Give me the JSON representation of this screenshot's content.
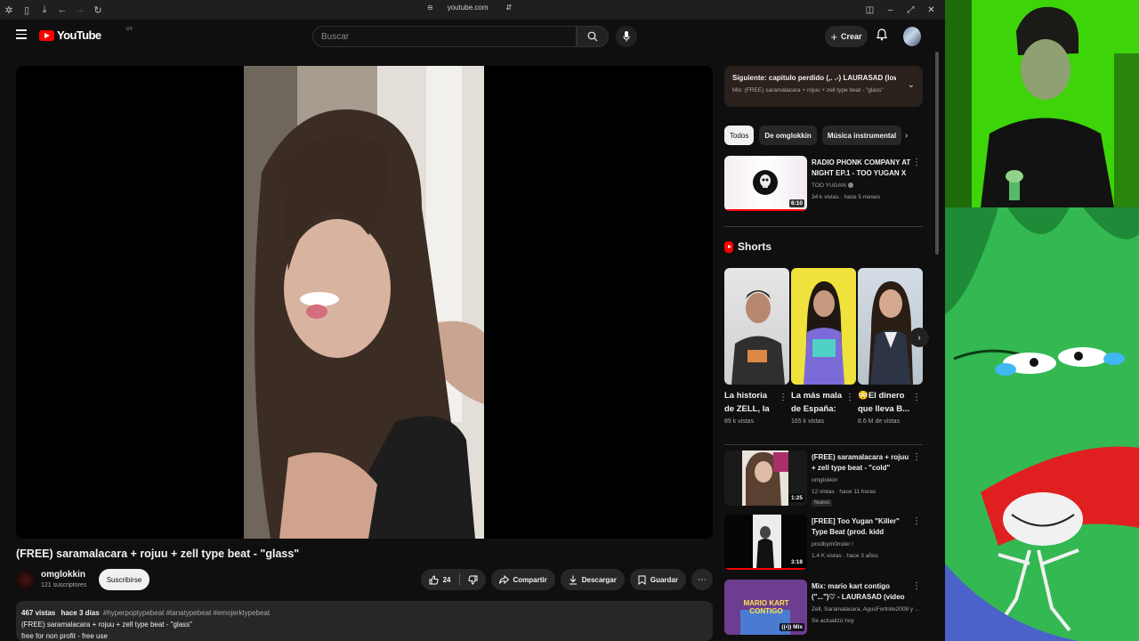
{
  "browser": {
    "url": "youtube.com"
  },
  "masthead": {
    "logo_text": "YouTube",
    "country_code": "UY",
    "search_placeholder": "Buscar",
    "create_label": "Crear"
  },
  "video": {
    "title": "(FREE) saramalacara + rojuu + zell type beat - \"glass\"",
    "channel_name": "omglokkin",
    "subscribers": "121 suscriptores",
    "subscribe_label": "Suscribirse",
    "likes": "24",
    "share_label": "Compartir",
    "download_label": "Descargar",
    "save_label": "Guardar",
    "description": {
      "views": "467 vistas",
      "date": "hace 3 días",
      "tags": "#hyperpoptypebeat #tanatypebeat #emojerktypebeat",
      "line2": "(FREE) saramalacara + rojuu + zell type beat - \"glass\"",
      "line3": "free for non profit - free use"
    }
  },
  "mix_panel": {
    "next_label": "Siguiente: capitulo perdido (,. .-) LAURASAD (lowc...",
    "mix_label": "Mix: (FREE) saramalacara + rojuu + zell type beat - \"glass\""
  },
  "chips": [
    "Todos",
    "De omglokkin",
    "Música instrumental"
  ],
  "recommended_top": {
    "title": "RADIO PHONK COMPANY AT NIGHT EP.1 - TOO YUGAN X ...",
    "channel": "TOO YUGAN",
    "meta": "34 k vistas · hace 5 meses",
    "duration": "6:10",
    "progress": 1.0
  },
  "shorts": {
    "heading": "Shorts",
    "items": [
      {
        "title": "La historia de ZELL, la ...",
        "views": "89 k vistas"
      },
      {
        "title": "La más mala de España: ...",
        "views": "165 k vistas"
      },
      {
        "title": "😳El dinero que lleva B...",
        "views": "8.6 M de vistas"
      }
    ]
  },
  "recommended": [
    {
      "title": "(FREE) saramalacara + rojuu + zell type beat - \"cold\"",
      "channel": "omglokkin",
      "meta": "12 vistas · hace 11 horas",
      "badge": "Nuevo",
      "duration": "1:25"
    },
    {
      "title": "[FREE] Too Yugan \"Killer\" Type Beat (prod. kidd m0nster)",
      "channel": "prodbym0nster !",
      "meta": "1.4 K vistas · hace 3 años",
      "duration": "3:18",
      "progress": 1.0
    },
    {
      "title": "Mix: mario kart contigo (\"...\")♡ - LAURASAD (video oficial)",
      "channel": "Zell, Saramalacara, AgusFortnite2008 y ...",
      "meta": "Se actualizó hoy",
      "duration": "Mix",
      "thumb_text": "MARIO KART CONTIGO"
    }
  ],
  "colors": {
    "background": "#0f0f0f",
    "accent": "#ff0000",
    "chip_bg": "#272727",
    "webcam_green": "#3dd40a",
    "meme_green": "#33b852"
  }
}
